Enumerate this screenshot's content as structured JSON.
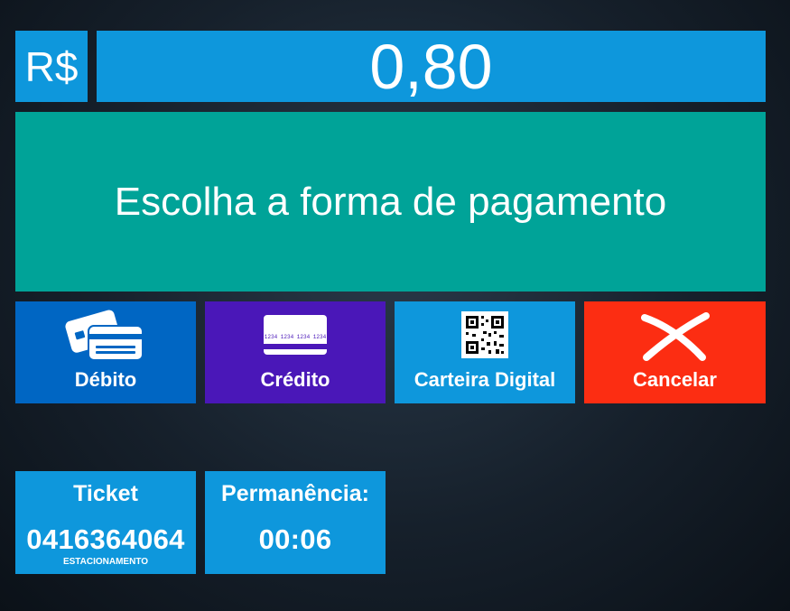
{
  "header": {
    "currency_symbol": "R$",
    "amount": "0,80"
  },
  "message": "Escolha a forma de pagamento",
  "payment_options": [
    {
      "label": "Débito",
      "icon": "debit-cards-icon"
    },
    {
      "label": "Crédito",
      "icon": "credit-card-icon",
      "card_number": "1234 1234 1234 1234"
    },
    {
      "label": "Carteira Digital",
      "icon": "qr-code-icon"
    },
    {
      "label": "Cancelar",
      "icon": "cancel-x-icon"
    }
  ],
  "ticket": {
    "title": "Ticket",
    "number": "0416364064",
    "type": "ESTACIONAMENTO"
  },
  "permanence": {
    "title": "Permanência:",
    "time": "00:06"
  },
  "colors": {
    "primary_blue": "#0e97dc",
    "message_teal": "#00a398",
    "debit_blue": "#0066c3",
    "credit_purple": "#4a17b8",
    "cancel_red": "#fc2d12"
  }
}
